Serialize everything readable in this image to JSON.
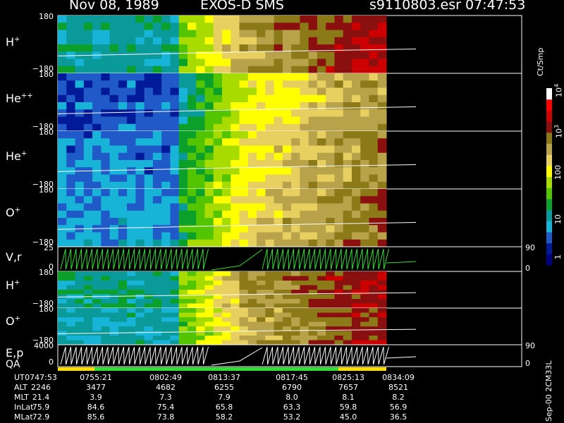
{
  "header": {
    "date": "Nov 08, 1989",
    "instrument": "EXOS-D SMS",
    "file": "s9110803.esr",
    "time": "07:47:53"
  },
  "colors": {
    "background": "#000000",
    "colormap": [
      "#000080",
      "#001a9a",
      "#1f5ac8",
      "#17b4d8",
      "#0a9a9a",
      "#0aa02a",
      "#52c400",
      "#a8dc00",
      "#ffff00",
      "#e8d060",
      "#b8a24a",
      "#8c7a18",
      "#8a0f0f",
      "#cc0000",
      "#ff0000",
      "#ffffff"
    ],
    "trace_line": "#ffffff",
    "counter_line": "#33dd33",
    "qa_good": "#33dd33",
    "qa_warn": "#ffdd00"
  },
  "chart_data": {
    "type": "heatmap",
    "panels": [
      {
        "label": "H",
        "charge": "+",
        "ytop": "180",
        "ybottom": "−180",
        "kind": "spectrogram"
      },
      {
        "label": "He",
        "charge": "++",
        "ytop": "180",
        "ybottom": "−180",
        "kind": "spectrogram"
      },
      {
        "label": "He",
        "charge": "+",
        "ytop": "180",
        "ybottom": "−180",
        "kind": "spectrogram"
      },
      {
        "label": "O",
        "charge": "+",
        "ytop": "180",
        "ybottom": "−180",
        "kind": "spectrogram"
      },
      {
        "label": "V,r",
        "charge": "",
        "ytop": "25",
        "ybottom": "0",
        "rtop": "90",
        "rbottom": "0",
        "kind": "line"
      },
      {
        "label": "H",
        "charge": "+",
        "ytop": "180",
        "ybottom": "−180",
        "kind": "spectrogram"
      },
      {
        "label": "O",
        "charge": "+",
        "ytop": "180",
        "ybottom": "−180",
        "kind": "spectrogram"
      },
      {
        "label": "E,p",
        "charge": "",
        "ytop": "4000",
        "ybottom": "0",
        "rtop": "90",
        "rbottom": "0",
        "kind": "line"
      }
    ],
    "qa_label": "QA",
    "colorbar": {
      "unit": "Ct/Smp",
      "ticks": [
        "1",
        "10",
        "100",
        "10",
        "10"
      ],
      "tick_exponents": [
        "",
        "",
        "",
        "3",
        "4"
      ],
      "range_log": [
        0,
        4
      ]
    },
    "annotation": {
      "rows": [
        {
          "name": "UT",
          "values": [
            "0747:53",
            "0755:21",
            "0802:49",
            "0813:37",
            "0817:45",
            "0825:13",
            "0834:09"
          ]
        },
        {
          "name": "ALT",
          "values": [
            "2246",
            "3477",
            "4682",
            "6255",
            "6790",
            "7657",
            "8521"
          ]
        },
        {
          "name": "MLT",
          "values": [
            "21.4",
            "3.9",
            "7.3",
            "7.9",
            "8.0",
            "8.1",
            "8.2"
          ]
        },
        {
          "name": "InLat",
          "values": [
            "75.9",
            "84.6",
            "75.4",
            "65.8",
            "63.3",
            "59.8",
            "56.9"
          ]
        },
        {
          "name": "MLat",
          "values": [
            "72.9",
            "85.6",
            "73.8",
            "58.2",
            "53.2",
            "45.0",
            "36.5"
          ]
        }
      ]
    },
    "side_date": "Sep-00  2CM33L"
  }
}
